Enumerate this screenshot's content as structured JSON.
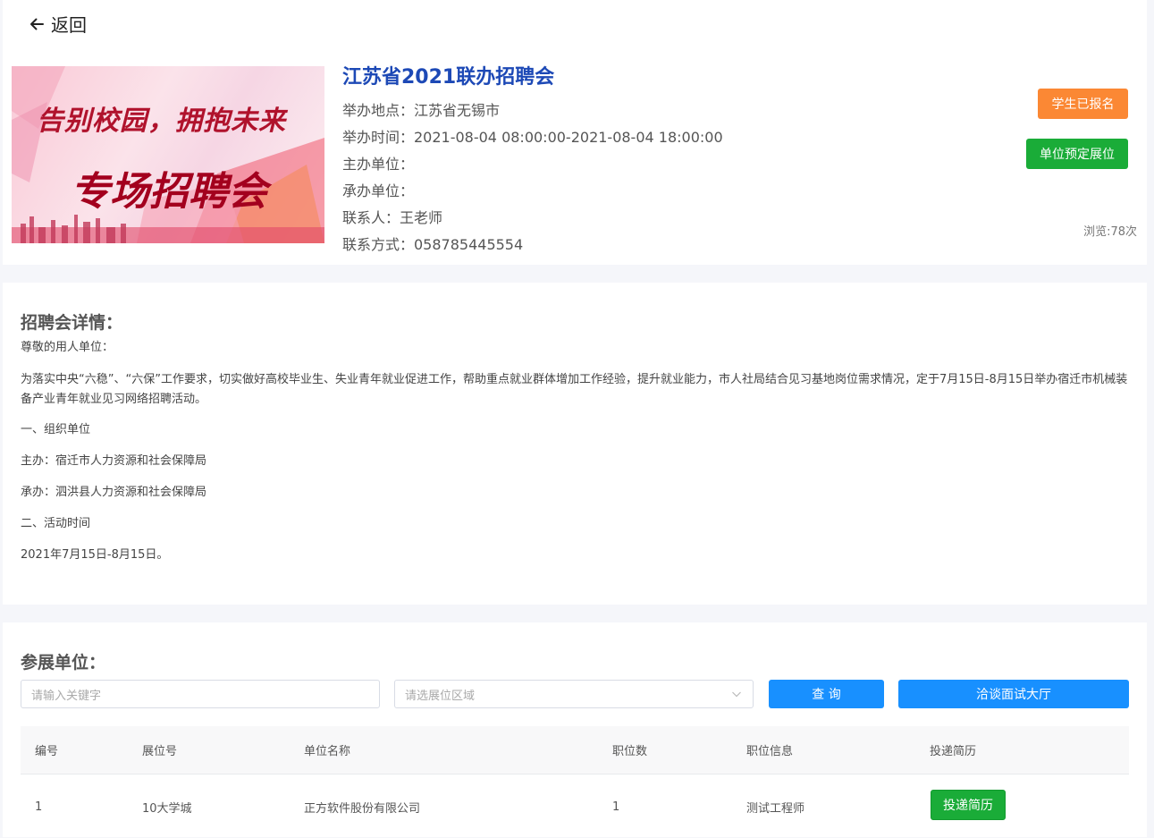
{
  "nav": {
    "back_label": "返回"
  },
  "fair": {
    "banner_line1": "告别校园，拥抱未来",
    "banner_line2": "专场招聘会",
    "title": "江苏省2021联办招聘会",
    "location": "举办地点：江苏省无锡市",
    "time": "举办时间：2021-08-04 08:00:00-2021-08-04 18:00:00",
    "host": "主办单位：",
    "organizer": "承办单位：",
    "contact": "联系人：王老师",
    "phone": "联系方式：058785445554",
    "student_btn": "学生已报名",
    "unit_btn": "单位预定展位",
    "views": "浏览:78次"
  },
  "detail": {
    "heading": "招聘会详情：",
    "greeting": "尊敬的用人单位：",
    "body": "为落实中央“六稳”、“六保”工作要求，切实做好高校毕业生、失业青年就业促进工作，帮助重点就业群体增加工作经验，提升就业能力，市人社局结合见习基地岗位需求情况，定于7月15日-8月15日举办宿迁市机械装备产业青年就业见习网络招聘活动。",
    "s1": "一、组织单位",
    "host": "主办：宿迁市人力资源和社会保障局",
    "org": "承办：泗洪县人力资源和社会保障局",
    "s2": "二、活动时间",
    "date": "2021年7月15日-8月15日。"
  },
  "units": {
    "heading": "参展单位：",
    "keyword_placeholder": "请输入关键字",
    "area_placeholder": "请选展位区域",
    "query_btn": "查 询",
    "hall_btn": "洽谈面试大厅",
    "columns": [
      "编号",
      "展位号",
      "单位名称",
      "职位数",
      "职位信息",
      "投递简历"
    ],
    "rows": [
      {
        "no": "1",
        "booth": "10大学城",
        "name": "正方软件股份有限公司",
        "count": "1",
        "jobs": "测试工程师",
        "action": "投递简历"
      }
    ]
  },
  "colors": {
    "title_blue": "#1d49b6",
    "orange": "#fb8834",
    "green": "#1aac38",
    "blue": "#1890ff"
  },
  "icons": [
    "arrow-left-icon",
    "chevron-down-icon"
  ]
}
